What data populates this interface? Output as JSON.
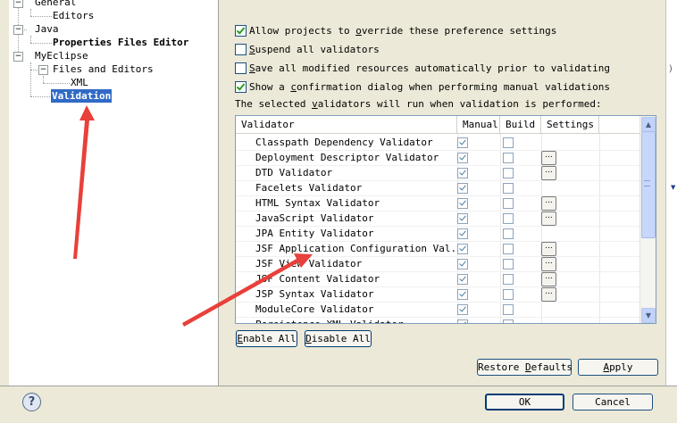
{
  "tree": {
    "items": [
      {
        "label": "General"
      },
      {
        "label": "Editors"
      },
      {
        "label": "Java"
      },
      {
        "label": "Properties Files Editor"
      },
      {
        "label": "MyEclipse"
      },
      {
        "label": "Files and Editors"
      },
      {
        "label": "XML"
      },
      {
        "label": "Validation"
      }
    ]
  },
  "options": {
    "allow_override": {
      "pre": "Allow projects to ",
      "u": "o",
      "post": "verride these preference settings",
      "checked": true
    },
    "suspend": {
      "pre": "",
      "u": "S",
      "post": "uspend all validators",
      "checked": false
    },
    "save_all": {
      "pre": "",
      "u": "S",
      "post": "ave all modified resources automatically prior to validating",
      "checked": false
    },
    "show_confirm": {
      "pre": "Show a ",
      "u": "c",
      "post": "onfirmation dialog when performing manual validations",
      "checked": true
    }
  },
  "info": {
    "pre": "The selected ",
    "u": "v",
    "post": "alidators will run when validation is performed:"
  },
  "table": {
    "headers": {
      "validator": "Validator",
      "manual": "Manual",
      "build": "Build",
      "settings": "Settings"
    },
    "rows": [
      {
        "name": "Classpath Dependency Validator",
        "manual": true,
        "build": false,
        "settings": false
      },
      {
        "name": "Deployment Descriptor Validator",
        "manual": true,
        "build": false,
        "settings": true
      },
      {
        "name": "DTD Validator",
        "manual": true,
        "build": false,
        "settings": true
      },
      {
        "name": "Facelets Validator",
        "manual": true,
        "build": false,
        "settings": false
      },
      {
        "name": "HTML Syntax Validator",
        "manual": true,
        "build": false,
        "settings": true
      },
      {
        "name": "JavaScript Validator",
        "manual": true,
        "build": false,
        "settings": true
      },
      {
        "name": "JPA Entity Validator",
        "manual": true,
        "build": false,
        "settings": false
      },
      {
        "name": "JSF Application Configuration Val...",
        "manual": true,
        "build": false,
        "settings": true
      },
      {
        "name": "JSF View Validator",
        "manual": true,
        "build": false,
        "settings": true
      },
      {
        "name": "JSF Content Validator",
        "manual": true,
        "build": false,
        "settings": true
      },
      {
        "name": "JSP Syntax Validator",
        "manual": true,
        "build": false,
        "settings": true
      },
      {
        "name": "ModuleCore Validator",
        "manual": true,
        "build": false,
        "settings": false
      },
      {
        "name": "Persistence XML Validator",
        "manual": true,
        "build": false,
        "settings": false
      }
    ],
    "settings_button": "..."
  },
  "buttons": {
    "enable_all": {
      "u": "E",
      "rest": "nable All"
    },
    "disable_all": {
      "u": "D",
      "rest": "isable All"
    },
    "restore_defaults": {
      "pre": "Restore ",
      "u": "D",
      "post": "efaults"
    },
    "apply": {
      "u": "A",
      "rest": "pply"
    },
    "ok": "OK",
    "cancel": "Cancel",
    "help": "?"
  },
  "colors": {
    "selection": "#316ac5",
    "arrow": "#e8403a",
    "checkmark": "#21a121"
  }
}
